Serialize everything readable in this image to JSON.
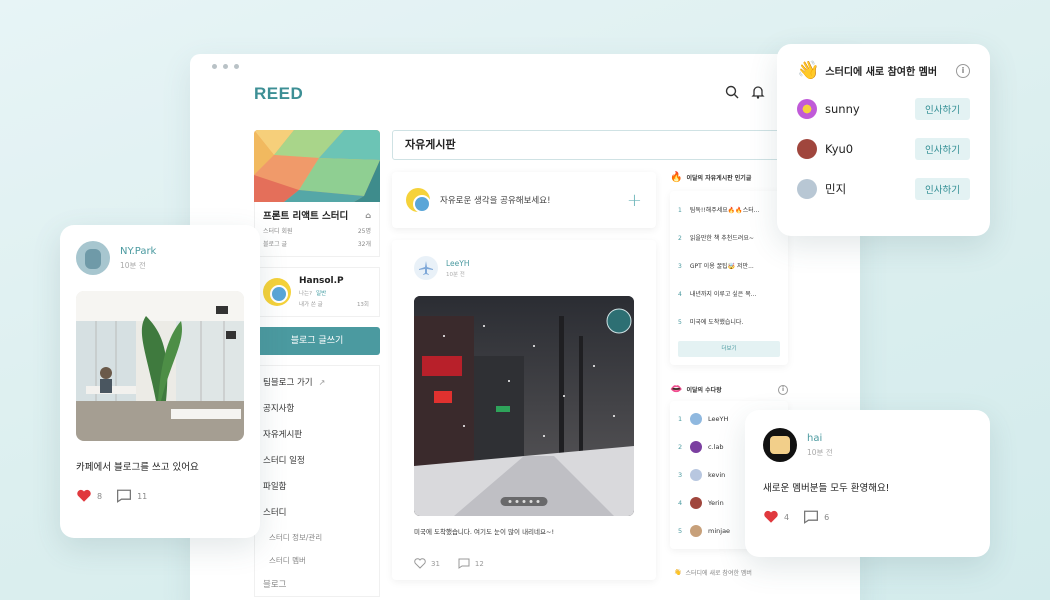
{
  "app": {
    "brand": "REED"
  },
  "board": {
    "title": "자유게시판",
    "composer_placeholder": "자유로운 생각을 공유해보세요!"
  },
  "sidebar": {
    "study": {
      "title": "프론트 리액트 스터디",
      "rows": [
        {
          "label": "스터디 회원",
          "value": "25명"
        },
        {
          "label": "블로그 글",
          "value": "32개"
        }
      ]
    },
    "user": {
      "name": "Hansol.P",
      "role_label": "나는?",
      "role_value": "일반",
      "posts_label": "내가 쓴 글",
      "posts_value": "13회"
    },
    "write_button": "블로그 글쓰기",
    "menu": [
      "팀블로그 가기",
      "공지사항",
      "자유게시판",
      "스터디 일정",
      "파일함",
      "스터디"
    ],
    "submenu": [
      "스터디 정보/관리",
      "스터디 멤버"
    ],
    "menu_last": "블로그"
  },
  "post": {
    "author": "LeeYH",
    "time": "10분 전",
    "text": "미국에 도착했습니다. 여기도 눈이 많이 내리네요~!",
    "likes": "31",
    "comments": "12"
  },
  "popular": {
    "title": "이달의 자유게시판 인기글",
    "items": [
      {
        "num": "1",
        "text": "팀독!!해주세요🔥🔥스터..."
      },
      {
        "num": "2",
        "text": "읽을만한 책 추천드려요~"
      },
      {
        "num": "3",
        "text": "GPT 이용 꿀팁🤯 저만..."
      },
      {
        "num": "4",
        "text": "내년까지 이루고 싶은 목..."
      },
      {
        "num": "5",
        "text": "미국에 도착했습니다."
      }
    ],
    "more": "더보기"
  },
  "chat_rank": {
    "title": "이달의 수다왕",
    "items": [
      {
        "num": "1",
        "name": "LeeYH",
        "color": "#8fb8df"
      },
      {
        "num": "2",
        "name": "c.lab",
        "color": "#7b3fa0"
      },
      {
        "num": "3",
        "name": "kevin",
        "color": "#b8c7e0"
      },
      {
        "num": "4",
        "name": "Yerin",
        "color": "#a0463d"
      },
      {
        "num": "5",
        "name": "minjae",
        "color": "#c7a07a"
      }
    ]
  },
  "footer_note": "스터디에 새로 참여한 멤버",
  "card_left": {
    "name": "NY.Park",
    "time": "10분 전",
    "text": "카페에서 블로그를 쓰고 있어요",
    "likes": "8",
    "comments": "11"
  },
  "card_right": {
    "name": "hai",
    "time": "10분 전",
    "text": "새로운 멤버분들 모두 환영해요!",
    "likes": "4",
    "comments": "6"
  },
  "members": {
    "title": "스터디에 새로 참여한 멤버",
    "button": "인사하기",
    "items": [
      {
        "name": "sunny"
      },
      {
        "name": "Kyu0"
      },
      {
        "name": "민지"
      }
    ]
  },
  "colors": {
    "accent": "#4b9aa0",
    "heart": "#e0393e"
  }
}
